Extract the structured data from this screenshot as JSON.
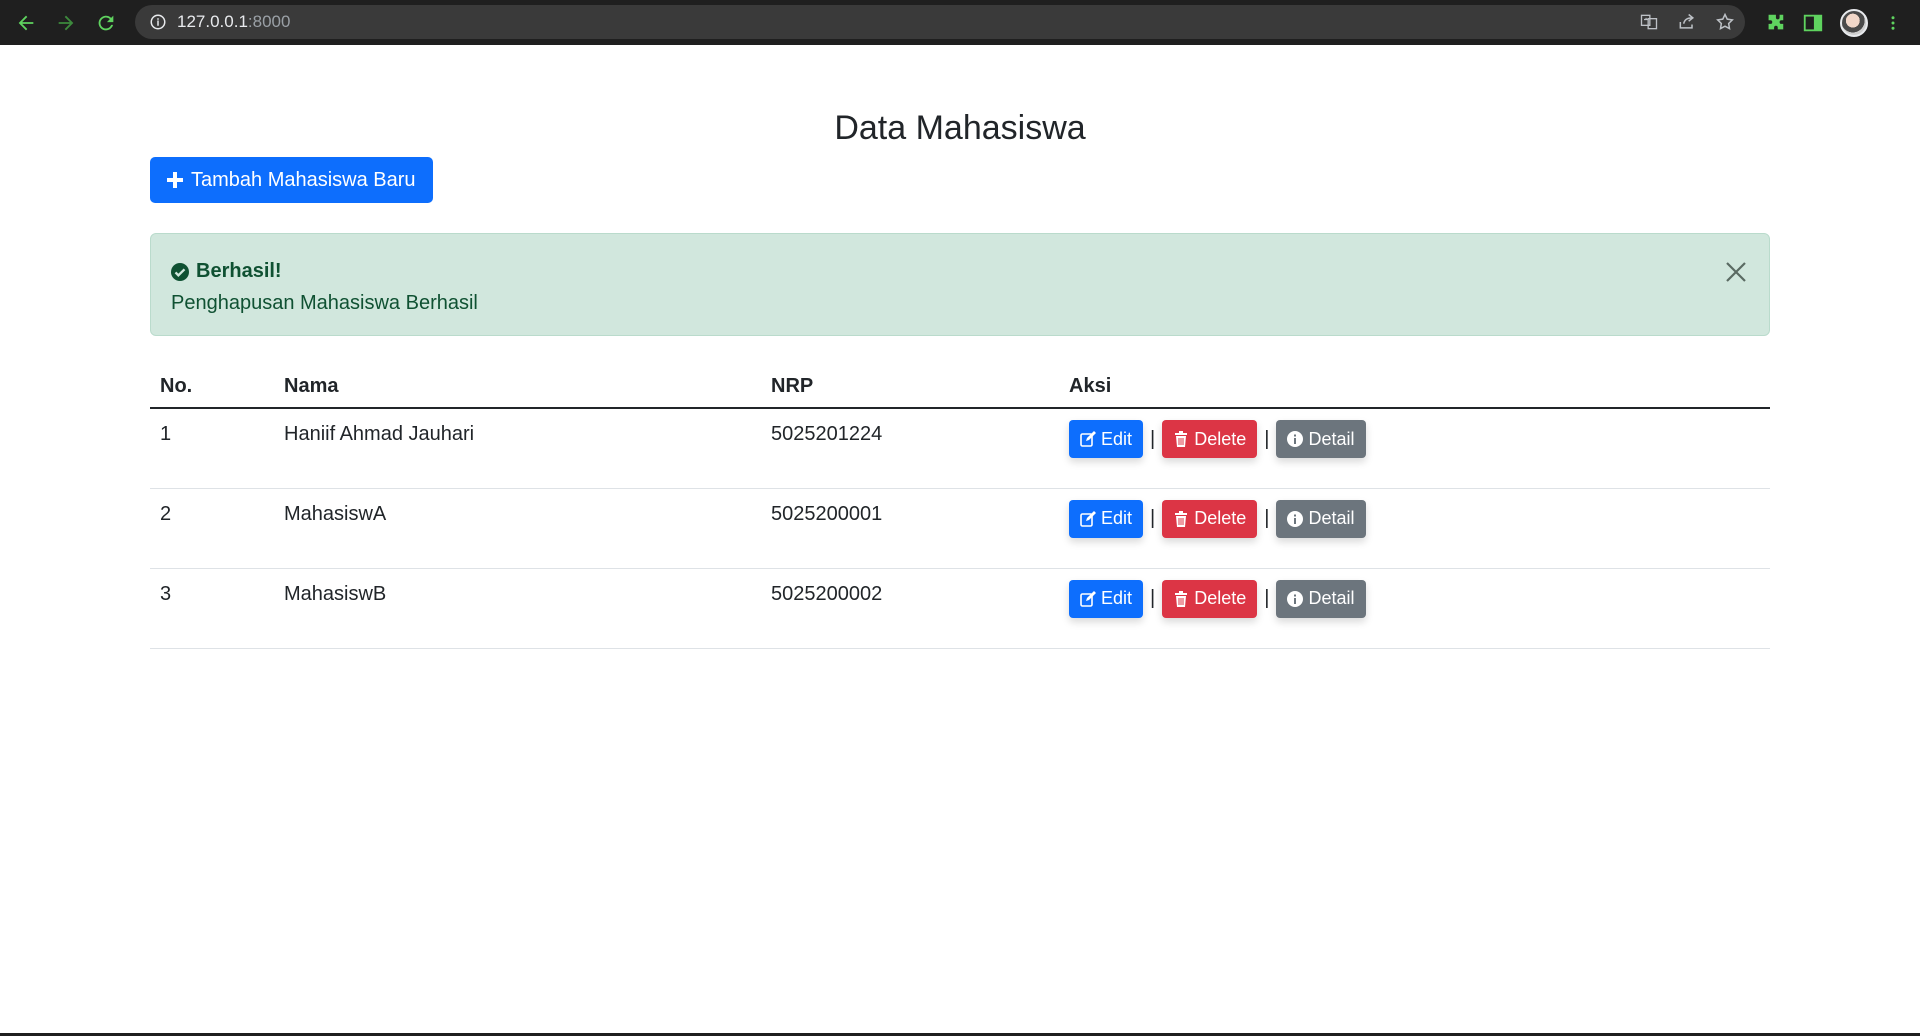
{
  "browser": {
    "url_host": "127.0.0.1",
    "url_port": ":8000"
  },
  "page": {
    "title": "Data Mahasiswa",
    "add_button_label": "Tambah Mahasiswa Baru"
  },
  "alert": {
    "heading": "Berhasil!",
    "message": "Penghapusan Mahasiswa Berhasil"
  },
  "table": {
    "headers": [
      "No.",
      "Nama",
      "NRP",
      "Aksi"
    ],
    "rows": [
      {
        "no": "1",
        "nama": "Haniif Ahmad Jauhari",
        "nrp": "5025201224"
      },
      {
        "no": "2",
        "nama": "MahasiswA",
        "nrp": "5025200001"
      },
      {
        "no": "3",
        "nama": "MahasiswB",
        "nrp": "5025200002"
      }
    ],
    "actions": {
      "edit": "Edit",
      "delete": "Delete",
      "detail": "Detail",
      "separator": "|"
    }
  },
  "colors": {
    "primary": "#0d6efd",
    "danger": "#dc3545",
    "secondary": "#6c757d",
    "alert_bg": "#d1e7dd",
    "alert_text": "#0f5132"
  }
}
